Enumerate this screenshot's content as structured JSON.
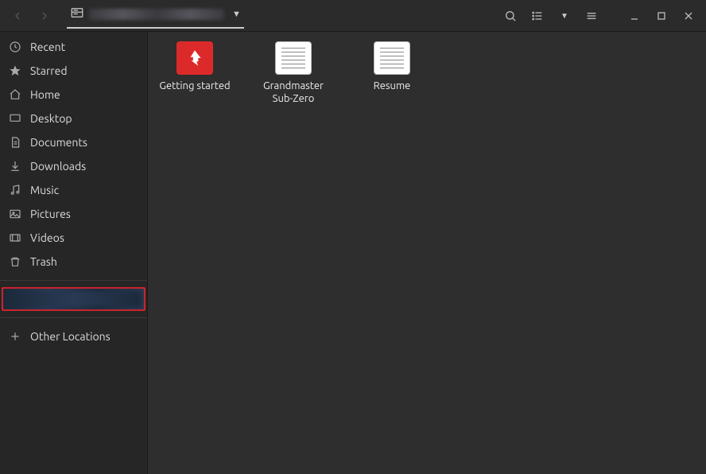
{
  "sidebar": {
    "items": [
      {
        "label": "Recent"
      },
      {
        "label": "Starred"
      },
      {
        "label": "Home"
      },
      {
        "label": "Desktop"
      },
      {
        "label": "Documents"
      },
      {
        "label": "Downloads"
      },
      {
        "label": "Music"
      },
      {
        "label": "Pictures"
      },
      {
        "label": "Videos"
      },
      {
        "label": "Trash"
      }
    ],
    "other_locations_label": "Other Locations"
  },
  "files": [
    {
      "label": "Getting started",
      "kind": "pdf"
    },
    {
      "label": "Grandmaster Sub-Zero",
      "kind": "txt"
    },
    {
      "label": "Resume",
      "kind": "txt"
    }
  ]
}
